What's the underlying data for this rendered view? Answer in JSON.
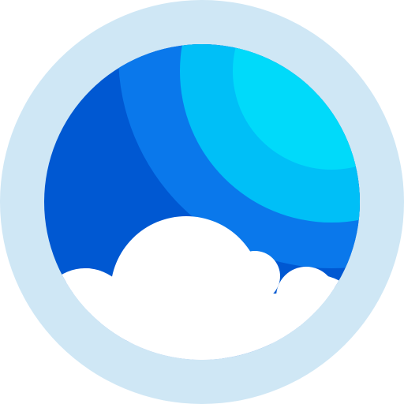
{
  "icon": {
    "name": "weather-sky-cloud-icon",
    "colors": {
      "outer_ring": "#cfe7f5",
      "sky_dark": "#0058d2",
      "sky_mid": "#0a78eb",
      "sky_light": "#00bff7",
      "sky_bright": "#00dafa",
      "cloud": "#ffffff"
    }
  }
}
